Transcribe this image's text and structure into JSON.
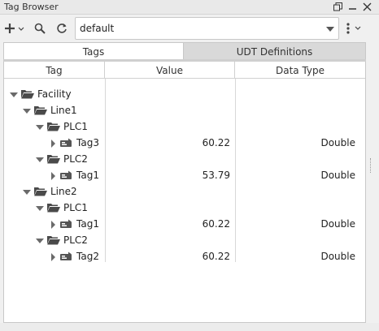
{
  "window": {
    "title": "Tag Browser",
    "icons": [
      "restore-icon",
      "minimize-icon",
      "close-icon"
    ]
  },
  "toolbar": {
    "add_icon": "plus-icon",
    "search_icon": "search-icon",
    "refresh_icon": "refresh-icon",
    "menu_icon": "kebab-menu-icon",
    "provider": "default"
  },
  "tabs": [
    {
      "label": "Tags",
      "active": true
    },
    {
      "label": "UDT Definitions",
      "active": false
    }
  ],
  "table": {
    "columns": [
      "Tag",
      "Value",
      "Data Type"
    ],
    "rows": [
      {
        "name": "Facility",
        "kind": "folder",
        "depth": 0,
        "expanded": true,
        "value": "",
        "dtype": ""
      },
      {
        "name": "Line1",
        "kind": "folder",
        "depth": 1,
        "expanded": true,
        "value": "",
        "dtype": ""
      },
      {
        "name": "PLC1",
        "kind": "folder",
        "depth": 2,
        "expanded": true,
        "value": "",
        "dtype": ""
      },
      {
        "name": "Tag3",
        "kind": "tag",
        "depth": 3,
        "expanded": false,
        "value": "60.22",
        "dtype": "Double"
      },
      {
        "name": "PLC2",
        "kind": "folder",
        "depth": 2,
        "expanded": true,
        "value": "",
        "dtype": ""
      },
      {
        "name": "Tag1",
        "kind": "tag",
        "depth": 3,
        "expanded": false,
        "value": "53.79",
        "dtype": "Double"
      },
      {
        "name": "Line2",
        "kind": "folder",
        "depth": 1,
        "expanded": true,
        "value": "",
        "dtype": ""
      },
      {
        "name": "PLC1",
        "kind": "folder",
        "depth": 2,
        "expanded": true,
        "value": "",
        "dtype": ""
      },
      {
        "name": "Tag1",
        "kind": "tag",
        "depth": 3,
        "expanded": false,
        "value": "60.22",
        "dtype": "Double"
      },
      {
        "name": "PLC2",
        "kind": "folder",
        "depth": 2,
        "expanded": true,
        "value": "",
        "dtype": ""
      },
      {
        "name": "Tag2",
        "kind": "tag",
        "depth": 3,
        "expanded": false,
        "value": "60.22",
        "dtype": "Double"
      }
    ]
  },
  "colors": {
    "folder": "#4a4a4a",
    "tag_icon": "#555555",
    "expander": "#6a6a6a"
  }
}
